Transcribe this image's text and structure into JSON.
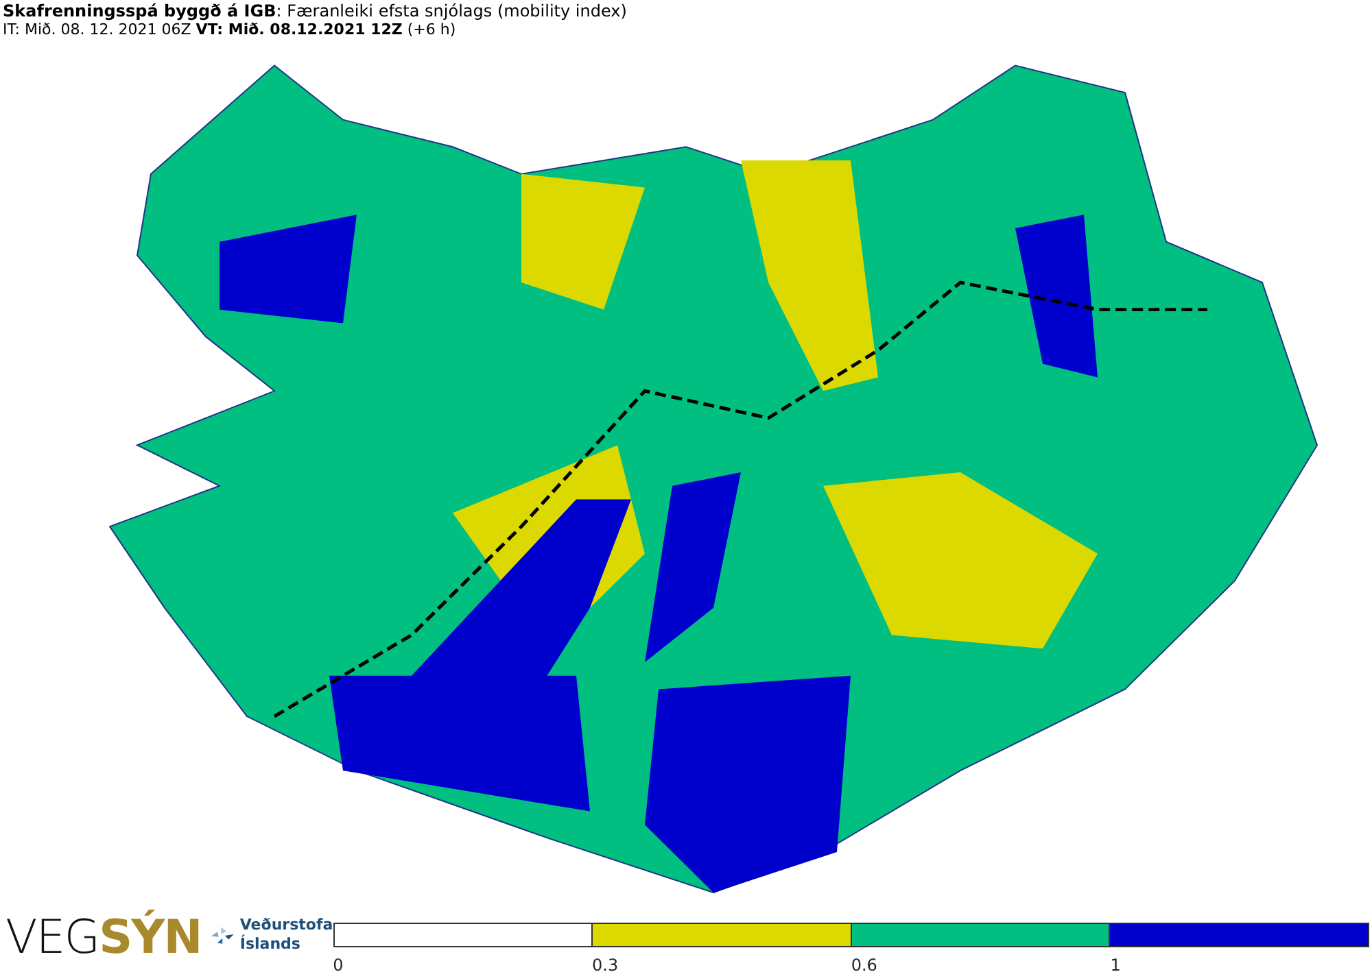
{
  "header": {
    "title": "**Skafrenningsspá byggð á IGB**: Færanleiki efsta snjólags (mobility index)",
    "subtitle": "IT: Mið. 08. 12. 2021 06Z **VT: Mið. 08.12.2021 12Z** (+6 h)"
  },
  "logos": {
    "vegsyn": "VEG**SÝN**",
    "institute_lines": [
      "Veðurstofa",
      "Íslands"
    ]
  },
  "legend": [
    {
      "label": "0",
      "color": "#ffffff"
    },
    {
      "label": "0.3",
      "color": "#dcd900"
    },
    {
      "label": "0.6",
      "color": "#00bf80"
    },
    {
      "label": "1",
      "color": "#0000cc"
    }
  ]
}
